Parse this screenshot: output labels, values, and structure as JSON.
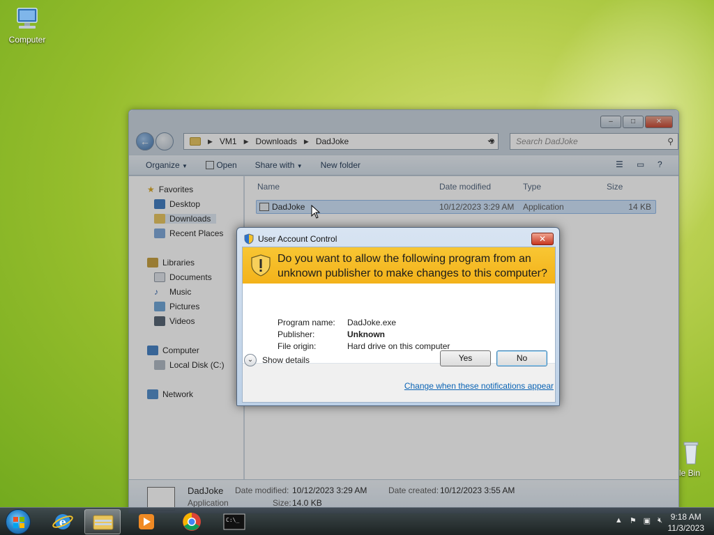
{
  "desktop": {
    "computer_icon_label": "Computer",
    "recycle_bin_label": "le Bin"
  },
  "explorer": {
    "breadcrumb": [
      "VM1",
      "Downloads",
      "DadJoke"
    ],
    "search_placeholder": "Search DadJoke",
    "toolbar": {
      "organize": "Organize",
      "open": "Open",
      "share_with": "Share with",
      "new_folder": "New folder"
    },
    "nav": {
      "favorites": "Favorites",
      "desktop": "Desktop",
      "downloads": "Downloads",
      "recent_places": "Recent Places",
      "libraries": "Libraries",
      "documents": "Documents",
      "music": "Music",
      "pictures": "Pictures",
      "videos": "Videos",
      "computer": "Computer",
      "local_disk": "Local Disk (C:)",
      "network": "Network"
    },
    "columns": {
      "name": "Name",
      "date_modified": "Date modified",
      "type": "Type",
      "size": "Size"
    },
    "file": {
      "name": "DadJoke",
      "date_modified": "10/12/2023 3:29 AM",
      "type": "Application",
      "size": "14 KB"
    },
    "details": {
      "name": "DadJoke",
      "modified_label": "Date modified:",
      "modified_value": "10/12/2023 3:29 AM",
      "created_label": "Date created:",
      "created_value": "10/12/2023 3:55 AM",
      "type_text": "Application",
      "size_label": "Size:",
      "size_value": "14.0 KB"
    }
  },
  "uac": {
    "title": "User Account Control",
    "question": "Do you want to allow the following program from an unknown publisher to make changes to this computer?",
    "program_name_label": "Program name:",
    "program_name_value": "DadJoke.exe",
    "publisher_label": "Publisher:",
    "publisher_value": "Unknown",
    "file_origin_label": "File origin:",
    "file_origin_value": "Hard drive on this computer",
    "show_details": "Show details",
    "yes": "Yes",
    "no": "No",
    "change_link": "Change when these notifications appear"
  },
  "taskbar": {
    "time": "9:18 AM",
    "date": "11/3/2023"
  },
  "colors": {
    "uac_banner": "#f3b21a",
    "link": "#0a63b4",
    "desktop_green": "#95bd2c"
  }
}
